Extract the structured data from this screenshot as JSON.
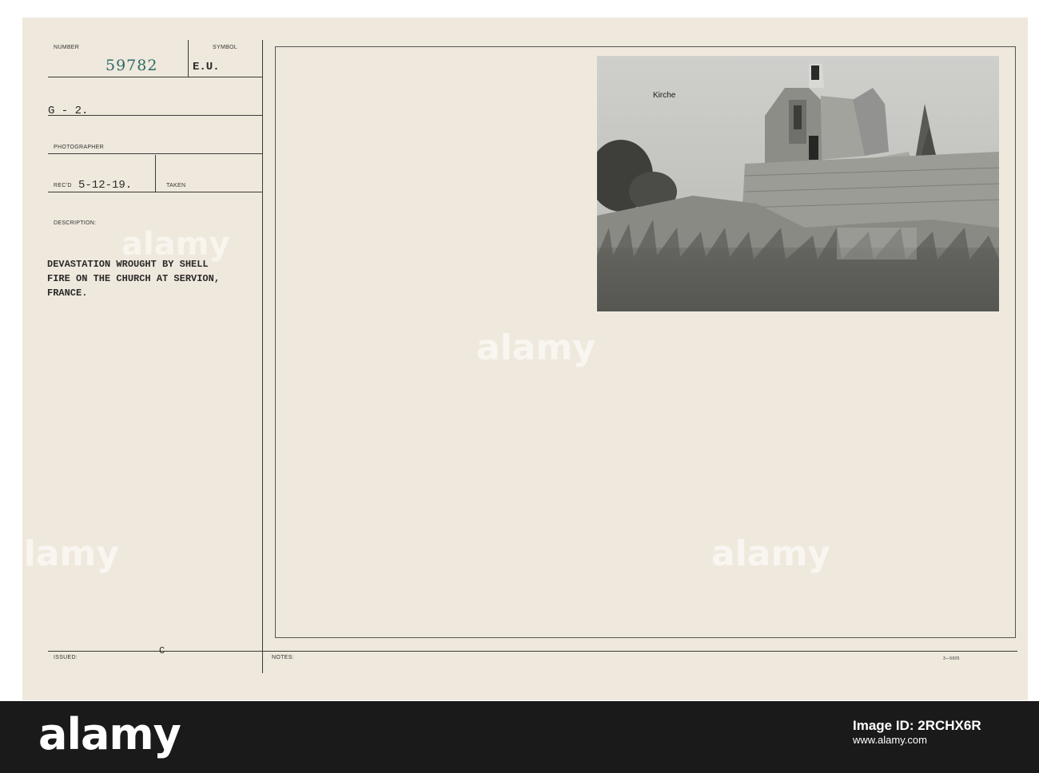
{
  "card": {
    "number_label": "NUMBER",
    "number_value": "59782",
    "symbol_label": "SYMBOL",
    "symbol_value": "E.U.",
    "unit_value": "G - 2.",
    "photographer_label": "PHOTOGRAPHER",
    "recd_label": "REC'D",
    "recd_value": "5-12-19.",
    "taken_label": "TAKEN",
    "description_label": "DESCRIPTION:",
    "description_lines": [
      "DEVASTATION WROUGHT BY SHELL",
      "FIRE ON THE CHURCH AT SERVION,",
      "FRANCE."
    ],
    "issued_label": "ISSUED:",
    "issued_value": "C",
    "notes_label": "NOTES:",
    "form_code": "3—5605"
  },
  "photo": {
    "caption": "Kirche"
  },
  "watermark": {
    "text": "alamy"
  },
  "footer": {
    "logo": "alamy",
    "image_id_label": "Image ID: 2RCHX6R",
    "url": "www.alamy.com"
  }
}
